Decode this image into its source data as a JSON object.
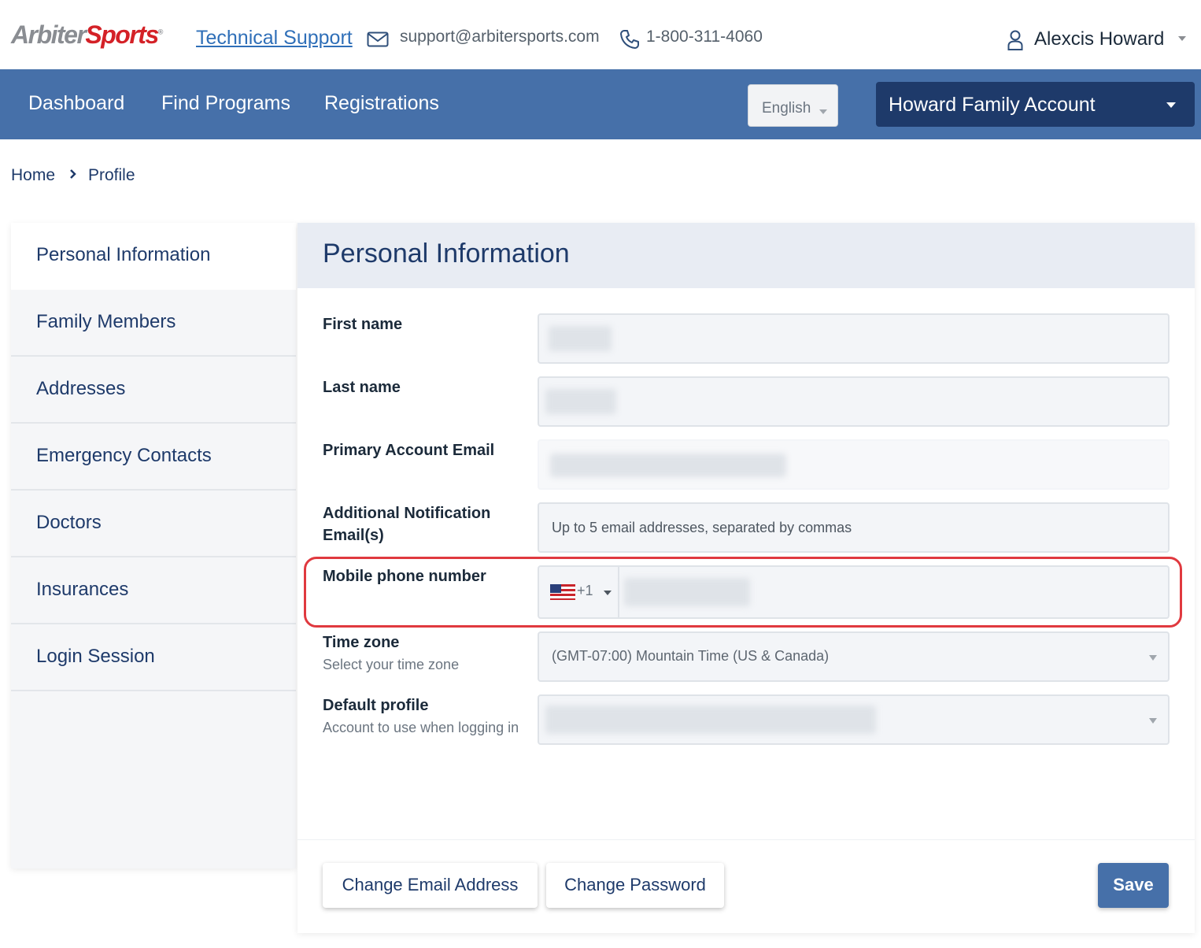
{
  "header": {
    "logo_primary": "Arbiter",
    "logo_secondary": "Sports",
    "support_link": "Technical Support",
    "support_email": "support@arbitersports.com",
    "support_phone": "1-800-311-4060",
    "user_name": "Alexcis Howard"
  },
  "nav": {
    "items": [
      "Dashboard",
      "Find Programs",
      "Registrations"
    ],
    "language": "English",
    "account": "Howard Family Account"
  },
  "breadcrumb": {
    "home": "Home",
    "current": "Profile"
  },
  "sidebar": {
    "items": [
      {
        "label": "Personal Information"
      },
      {
        "label": "Family Members"
      },
      {
        "label": "Addresses"
      },
      {
        "label": "Emergency Contacts"
      },
      {
        "label": "Doctors"
      },
      {
        "label": "Insurances"
      },
      {
        "label": "Login Session"
      }
    ],
    "active_index": 0
  },
  "form": {
    "title": "Personal Information",
    "first_name_label": "First name",
    "last_name_label": "Last name",
    "primary_email_label": "Primary Account Email",
    "additional_email_label": "Additional Notification Email(s)",
    "additional_email_placeholder": "Up to 5 email addresses, separated by commas",
    "mobile_label": "Mobile phone number",
    "country_code": "+1",
    "timezone_label": "Time zone",
    "timezone_sub": "Select your time zone",
    "timezone_value": "(GMT-07:00) Mountain Time (US & Canada)",
    "default_profile_label": "Default profile",
    "default_profile_sub": "Account to use when logging in"
  },
  "buttons": {
    "change_email": "Change Email Address",
    "change_password": "Change Password",
    "save": "Save"
  },
  "colors": {
    "nav_bg": "#4670a9",
    "account_bg": "#1e3a6a",
    "highlight": "#e0393f",
    "logo_red": "#d42127"
  }
}
